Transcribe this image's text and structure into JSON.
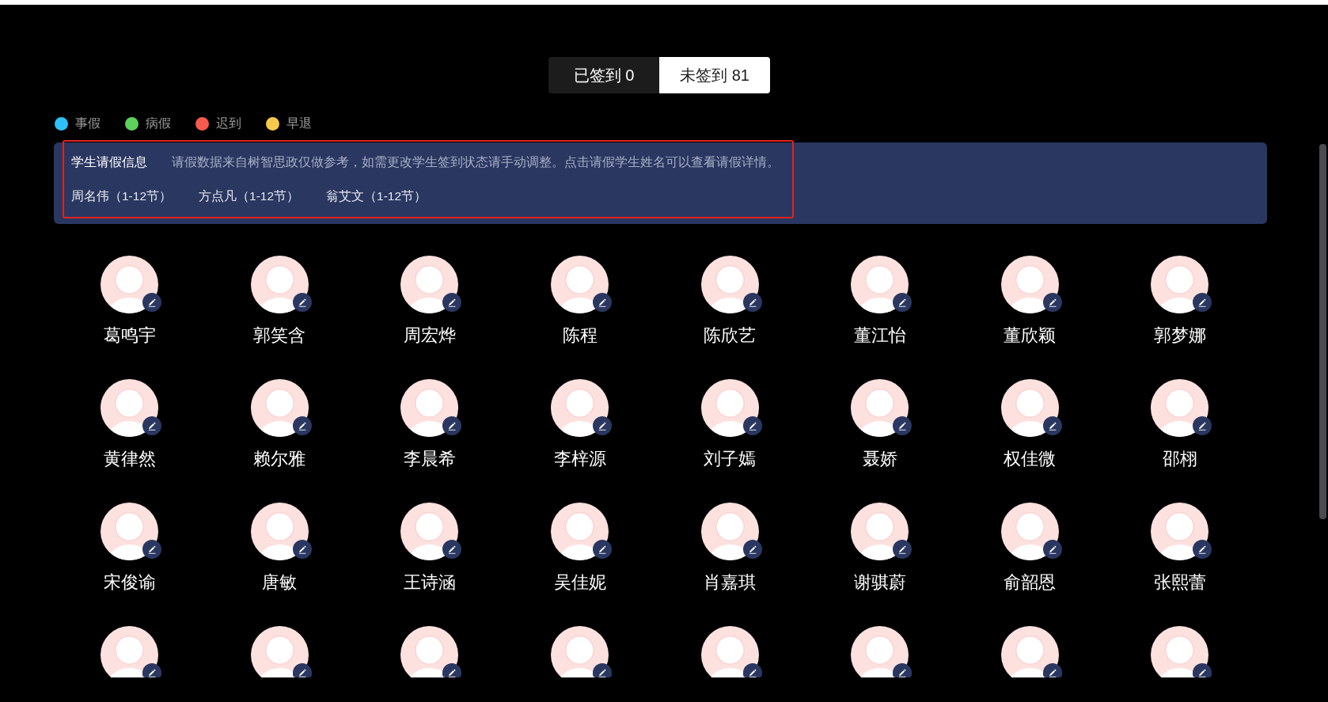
{
  "tabs": [
    {
      "label": "已签到 0",
      "selected": false
    },
    {
      "label": "未签到 81",
      "selected": true
    }
  ],
  "legend": [
    {
      "label": "事假",
      "color": "#2ec0f8"
    },
    {
      "label": "病假",
      "color": "#5cd25c"
    },
    {
      "label": "迟到",
      "color": "#f85a4e"
    },
    {
      "label": "早退",
      "color": "#f6c94d"
    }
  ],
  "leave_panel": {
    "title": "学生请假信息",
    "notice": "请假数据来自树智思政仅做参考，如需更改学生签到状态请手动调整。点击请假学生姓名可以查看请假详情。",
    "highlighted": true,
    "students": [
      "周名伟（1-12节）",
      "方点凡（1-12节）",
      "翁艾文（1-12节）"
    ]
  },
  "students": [
    {
      "name": "葛鸣宇",
      "clipped": false
    },
    {
      "name": "郭笑含",
      "clipped": false
    },
    {
      "name": "周宏烨",
      "clipped": false
    },
    {
      "name": "陈程",
      "clipped": false
    },
    {
      "name": "陈欣艺",
      "clipped": false
    },
    {
      "name": "董江怡",
      "clipped": false
    },
    {
      "name": "董欣颖",
      "clipped": false
    },
    {
      "name": "郭梦娜",
      "clipped": false
    },
    {
      "name": "黄律然",
      "clipped": false
    },
    {
      "name": "赖尔雅",
      "clipped": false
    },
    {
      "name": "李晨希",
      "clipped": false
    },
    {
      "name": "李梓源",
      "clipped": false
    },
    {
      "name": "刘子嫣",
      "clipped": false
    },
    {
      "name": "聂娇",
      "clipped": false
    },
    {
      "name": "权佳微",
      "clipped": false
    },
    {
      "name": "邵栩",
      "clipped": false
    },
    {
      "name": "宋俊谕",
      "clipped": false
    },
    {
      "name": "唐敏",
      "clipped": false
    },
    {
      "name": "王诗涵",
      "clipped": false
    },
    {
      "name": "吴佳妮",
      "clipped": false
    },
    {
      "name": "肖嘉琪",
      "clipped": false
    },
    {
      "name": "谢骐蔚",
      "clipped": false
    },
    {
      "name": "俞韶恩",
      "clipped": false
    },
    {
      "name": "张熙蕾",
      "clipped": false
    },
    {
      "clipped": true
    },
    {
      "clipped": true
    },
    {
      "clipped": true
    },
    {
      "clipped": true
    },
    {
      "clipped": true
    },
    {
      "clipped": true
    },
    {
      "clipped": true
    },
    {
      "clipped": true
    }
  ]
}
